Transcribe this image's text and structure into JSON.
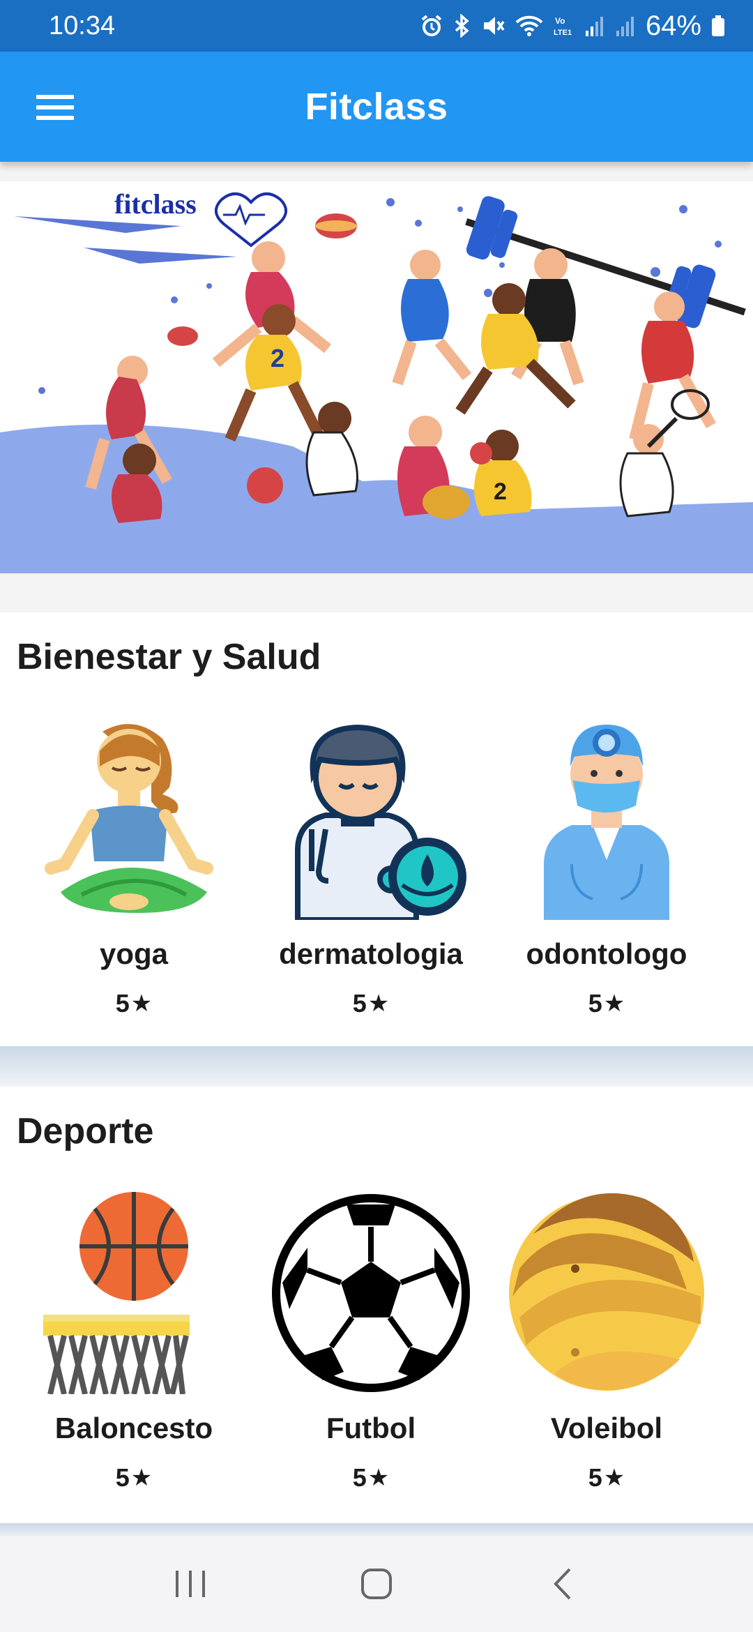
{
  "status_bar": {
    "time": "10:34",
    "battery": "64%",
    "icons": [
      "alarm-icon",
      "bluetooth-icon",
      "mute-icon",
      "wifi-icon",
      "volte-icon",
      "signal-icon",
      "signal-icon-2",
      "battery-icon"
    ]
  },
  "app_bar": {
    "title": "Fitclass",
    "menu_icon": "hamburger-menu-icon"
  },
  "banner": {
    "logo_text": "fitclass",
    "image": "sports-illustration"
  },
  "sections": [
    {
      "title": "Bienestar y Salud",
      "items": [
        {
          "name": "yoga",
          "rating": "5",
          "icon": "yoga-icon"
        },
        {
          "name": "dermatologia",
          "rating": "5",
          "icon": "dermatologist-icon"
        },
        {
          "name": "odontologo",
          "rating": "5",
          "icon": "dentist-icon"
        }
      ]
    },
    {
      "title": "Deporte",
      "items": [
        {
          "name": "Baloncesto",
          "rating": "5",
          "icon": "basketball-icon"
        },
        {
          "name": "Futbol",
          "rating": "5",
          "icon": "soccer-ball-icon"
        },
        {
          "name": "Voleibol",
          "rating": "5",
          "icon": "volleyball-icon"
        }
      ]
    }
  ],
  "nav_bar": {
    "buttons": [
      "recent-apps-icon",
      "home-icon",
      "back-icon"
    ]
  },
  "colors": {
    "status_bar": "#1a6fc2",
    "app_bar": "#2196f3",
    "logo": "#1b2fa6"
  }
}
